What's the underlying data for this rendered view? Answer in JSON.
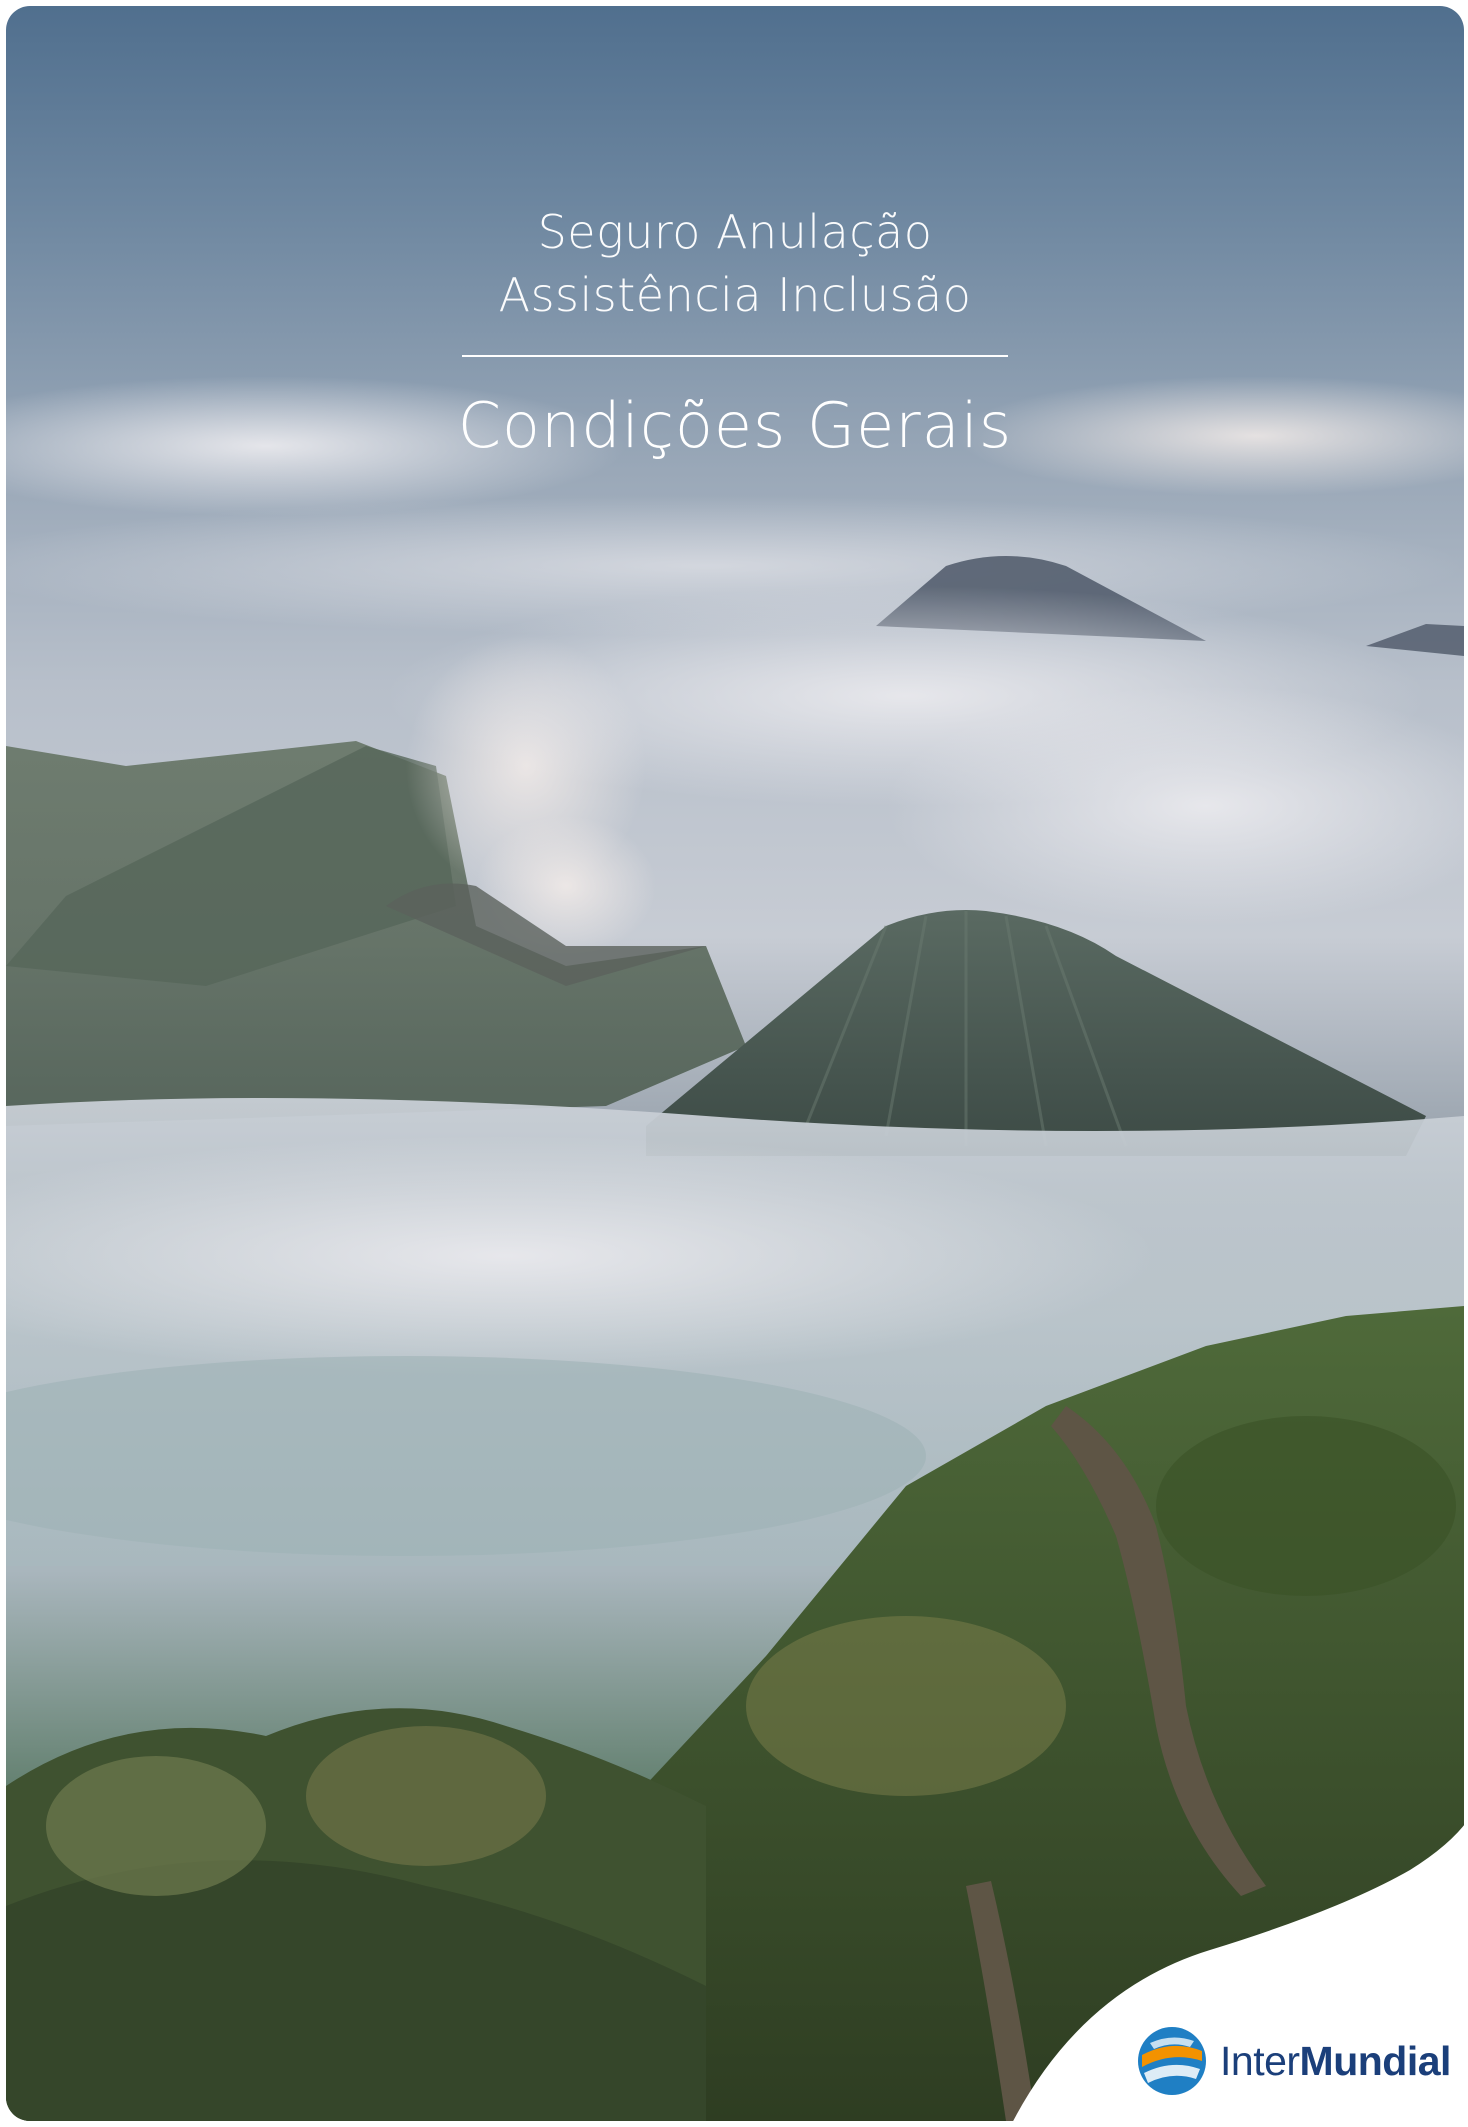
{
  "cover": {
    "subtitle_line1": "Seguro Anulação",
    "subtitle_line2": "Assistência Inclusão",
    "title": "Condições Gerais"
  },
  "brand": {
    "name_part1": "Inter",
    "name_part2": "Mundial",
    "text_color": "#1b3f7a",
    "accent_orange": "#f39200",
    "accent_blue": "#1f7fc4"
  },
  "background": {
    "image_subject": "volcanic landscape with clouds and forested ridge"
  }
}
